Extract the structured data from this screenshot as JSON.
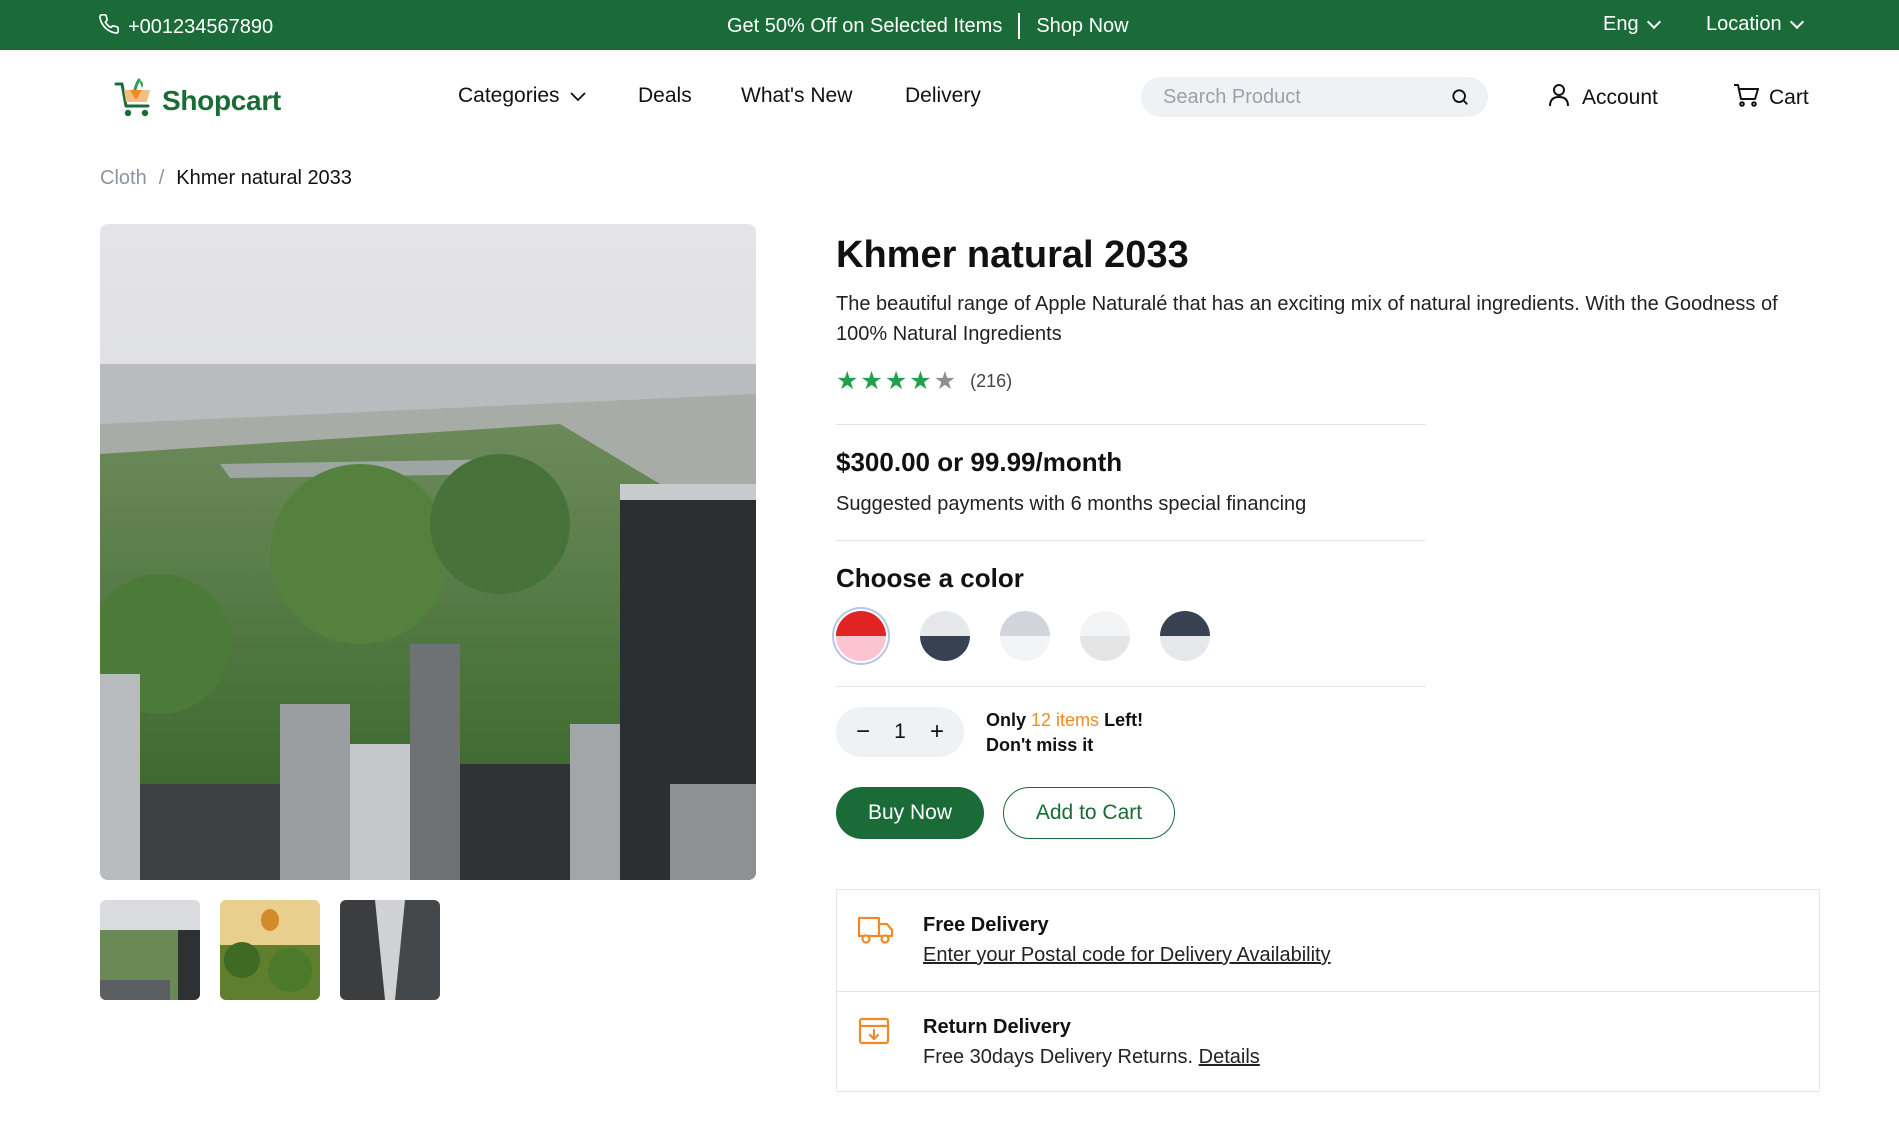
{
  "topbar": {
    "phone": "+001234567890",
    "promo_text": "Get 50% Off on Selected Items",
    "promo_link": "Shop Now",
    "language": "Eng",
    "location": "Location"
  },
  "header": {
    "brand": "Shopcart",
    "nav": [
      "Categories",
      "Deals",
      "What's New",
      "Delivery"
    ],
    "search_placeholder": "Search Product",
    "account": "Account",
    "cart": "Cart"
  },
  "breadcrumb": [
    "Cloth",
    "/",
    "Khmer natural 2033"
  ],
  "product": {
    "title": "Khmer natural 2033",
    "description": "The beautiful range of Apple Naturalé that has an exciting mix of natural ingredients. With the Goodness of 100% Natural Ingredients",
    "rating": 4.5,
    "review_count": "(216)",
    "price": "$300.00 or 99.99/month",
    "financing": "Suggested payments with 6 months special financing",
    "color_heading": "Choose a color",
    "colors": [
      {
        "top": "#e02424",
        "bottom": "#fbc4d0",
        "selected": true
      },
      {
        "top": "#e6e8eb",
        "bottom": "#374151",
        "selected": false
      },
      {
        "top": "#d1d5db",
        "bottom": "#f3f4f6",
        "selected": false
      },
      {
        "top": "#f3f4f6",
        "bottom": "#e5e5e5",
        "selected": false
      },
      {
        "top": "#374151",
        "bottom": "#e5e7eb",
        "selected": false
      }
    ],
    "quantity": "1",
    "stock_prefix": "Only",
    "stock_count": "12 items",
    "stock_suffix": "Left!",
    "stock_note": "Don't miss it",
    "buy_label": "Buy Now",
    "add_label": "Add to Cart"
  },
  "delivery": {
    "free_title": "Free Delivery",
    "free_link": "Enter your Postal code for Delivery Availability",
    "return_title": "Return Delivery",
    "return_text": "Free 30days Delivery Returns.",
    "return_link": "Details"
  },
  "colors": {
    "brand_green": "#1a6b38",
    "accent_orange": "#f08a24",
    "star_green": "#21a04e"
  }
}
